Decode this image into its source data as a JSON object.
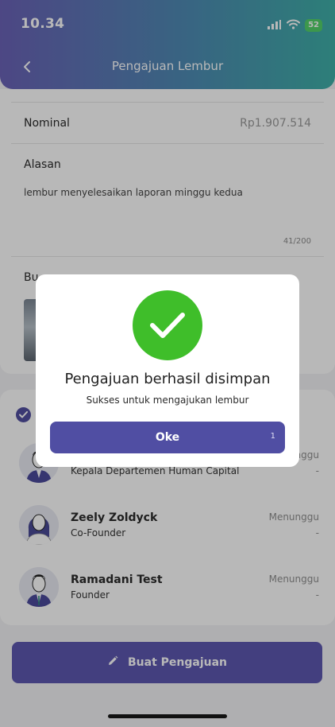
{
  "status_bar": {
    "time": "10.34",
    "battery": "52"
  },
  "header": {
    "title": "Pengajuan Lembur"
  },
  "form": {
    "nominal_label": "Nominal",
    "nominal_value": "Rp1.907.514",
    "reason_label": "Alasan",
    "reason_value": "lembur menyelesaikan laporan minggu kedua",
    "reason_counter": "41/200",
    "attachment_label_partial": "Bu"
  },
  "approvers": [
    {
      "name": "",
      "role": "Kepala Departemen Human Capital",
      "status": "nggu",
      "date": "-"
    },
    {
      "name": "Zeely Zoldyck",
      "role": "Co-Founder",
      "status": "Menunggu",
      "date": "-"
    },
    {
      "name": "Ramadani Test",
      "role": "Founder",
      "status": "Menunggu",
      "date": "-"
    }
  ],
  "submit": {
    "label": "Buat Pengajuan"
  },
  "modal": {
    "title": "Pengajuan berhasil disimpan",
    "subtitle": "Sukses untuk mengajukan lembur",
    "button_label": "Oke",
    "button_count": "1"
  },
  "colors": {
    "primary": "#504ea3",
    "success": "#3fbe2a",
    "header_start": "#6b63b8",
    "header_end": "#3fb0a8"
  }
}
